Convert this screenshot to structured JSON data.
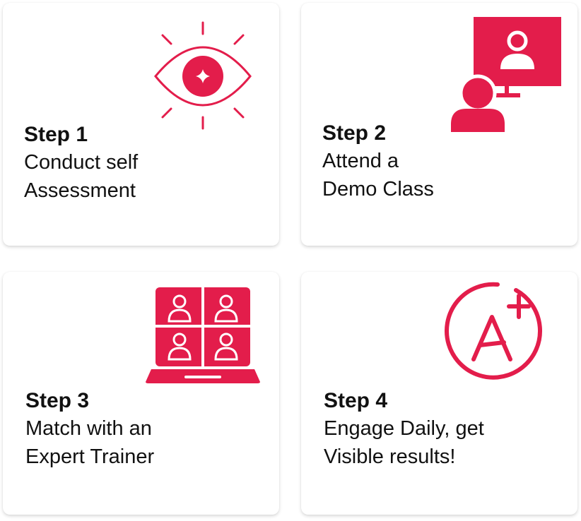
{
  "accent_color": "#E31D4B",
  "steps": [
    {
      "title": "Step 1",
      "line1": "Conduct self",
      "line2": "Assessment",
      "icon": "eye-icon"
    },
    {
      "title": "Step 2",
      "line1": "Attend a",
      "line2": "Demo Class",
      "icon": "online-presentation-icon"
    },
    {
      "title": "Step 3",
      "line1": "Match with an",
      "line2": "Expert Trainer",
      "icon": "video-call-laptop-icon"
    },
    {
      "title": "Step 4",
      "line1": "Engage Daily, get",
      "line2": "Visible results!",
      "icon": "a-plus-grade-icon"
    }
  ]
}
